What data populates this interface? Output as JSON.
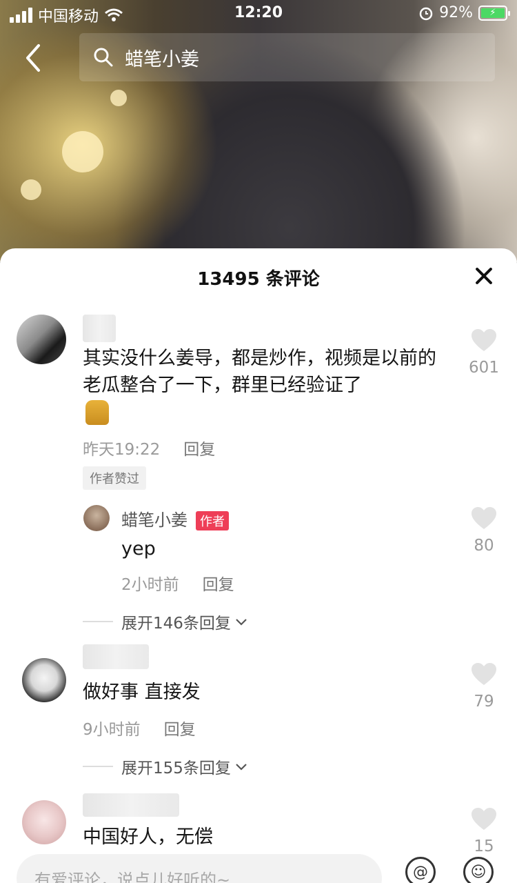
{
  "status": {
    "carrier": "中国移动",
    "time": "12:20",
    "battery": "92%"
  },
  "search": {
    "query": "蜡笔小姜"
  },
  "sheet": {
    "title": "13495 条评论"
  },
  "comments": [
    {
      "text": "其实没什么姜导，都是炒作，视频是以前的老瓜整合了一下，群里已经验证了",
      "time": "昨天19:22",
      "reply": "回复",
      "likes": "601",
      "badge": "作者赞过",
      "sub_reply": {
        "name": "蜡笔小姜",
        "tag": "作者",
        "text": "yep",
        "time": "2小时前",
        "reply": "回复",
        "likes": "80"
      },
      "expand": "展开146条回复"
    },
    {
      "text": "做好事 直接发",
      "time": "9小时前",
      "reply": "回复",
      "likes": "79",
      "expand": "展开155条回复"
    },
    {
      "text": "中国好人，无偿",
      "likes": "15"
    }
  ],
  "input": {
    "placeholder": "有爱评论，说点儿好听的~"
  },
  "icons": {
    "back": "chevron-left-icon",
    "search": "search-icon",
    "close": "close-icon",
    "heart": "heart-icon",
    "at": "at-icon",
    "emoji": "emoji-icon"
  }
}
